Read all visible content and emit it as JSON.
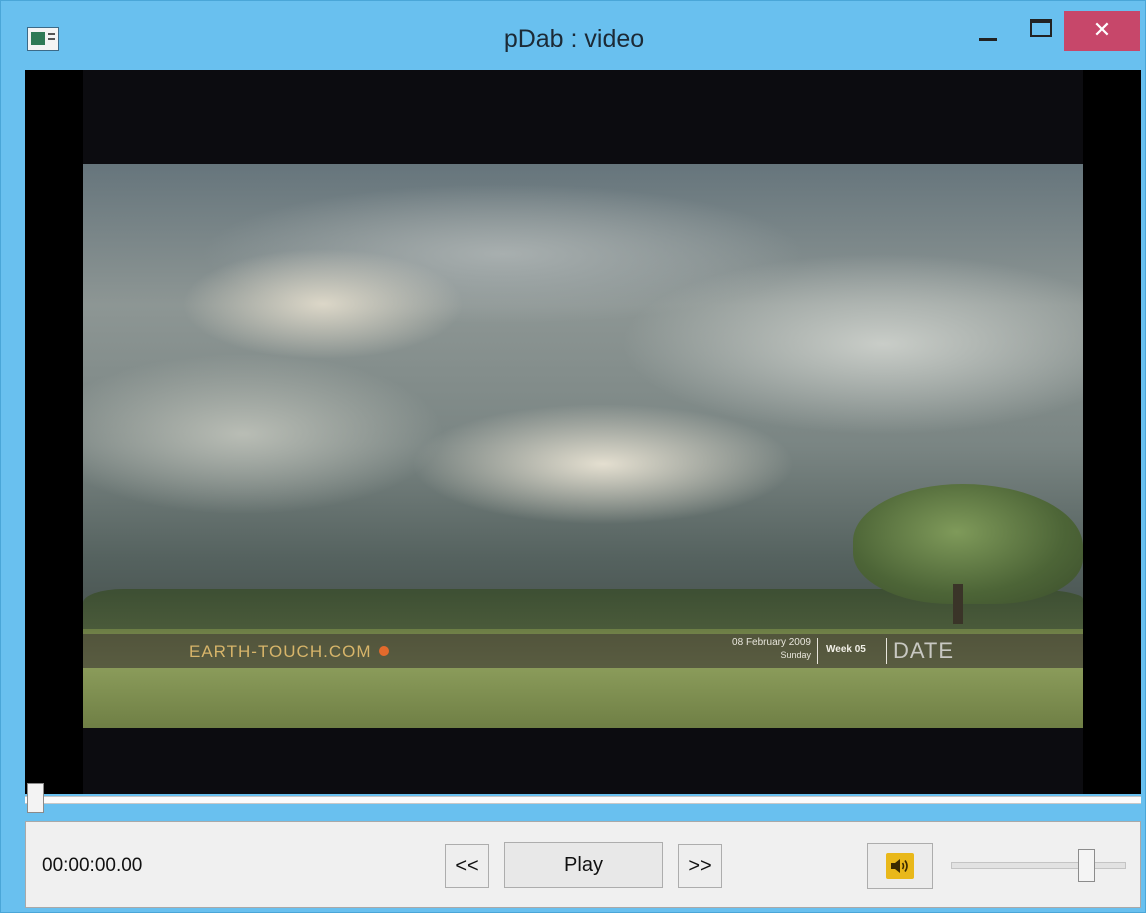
{
  "window": {
    "title": "pDab : video",
    "close_label": "✕"
  },
  "video": {
    "overlay": {
      "brand": "EARTH-TOUCH.COM",
      "date_line1": "08 February 2009",
      "date_line2": "Sunday",
      "week": "Week 05",
      "date_word": "DATE"
    },
    "seek_progress_fraction": 0.0
  },
  "controls": {
    "time": "00:00:00.00",
    "prev_label": "<<",
    "play_label": "Play",
    "next_label": ">>",
    "mute_icon": "speaker-icon",
    "volume_fraction": 0.78
  },
  "colors": {
    "titlebar": "#69c0ef",
    "close_button": "#c7476a",
    "speaker_accent": "#e9b81a"
  }
}
